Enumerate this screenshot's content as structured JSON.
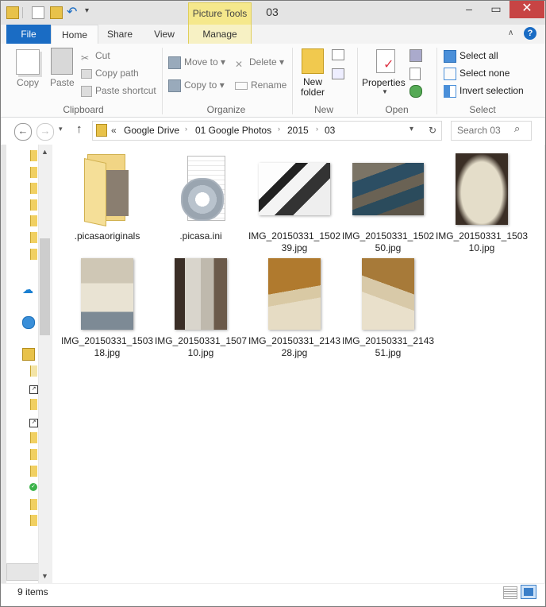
{
  "window": {
    "title": "03",
    "context_tab": "Picture Tools"
  },
  "tabs": {
    "file": "File",
    "home": "Home",
    "share": "Share",
    "view": "View",
    "manage": "Manage"
  },
  "ribbon": {
    "clipboard": {
      "copy": "Copy",
      "paste": "Paste",
      "cut": "Cut",
      "copy_path": "Copy path",
      "paste_shortcut": "Paste shortcut",
      "label": "Clipboard"
    },
    "organize": {
      "move_to": "Move to",
      "copy_to": "Copy to",
      "delete": "Delete",
      "rename": "Rename",
      "label": "Organize"
    },
    "new": {
      "new_folder_line1": "New",
      "new_folder_line2": "folder",
      "label": "New"
    },
    "open": {
      "properties": "Properties",
      "label": "Open"
    },
    "select": {
      "select_all": "Select all",
      "select_none": "Select none",
      "invert": "Invert selection",
      "label": "Select"
    }
  },
  "nav": {
    "breadcrumb": [
      "«",
      "Google Drive",
      "01 Google Photos",
      "2015",
      "03"
    ],
    "search_placeholder": "Search 03"
  },
  "files": [
    {
      "name": ".picasaoriginals",
      "kind": "folder"
    },
    {
      "name": ".picasa.ini",
      "kind": "ini"
    },
    {
      "name": "IMG_20150331_150239.jpg",
      "kind": "phones-bw"
    },
    {
      "name": "IMG_20150331_150250.jpg",
      "kind": "phones-color"
    },
    {
      "name": "IMG_20150331_150310.jpg",
      "kind": "box-tall"
    },
    {
      "name": "IMG_20150331_150318.jpg",
      "kind": "box-open"
    },
    {
      "name": "IMG_20150331_150710.jpg",
      "kind": "box-side"
    },
    {
      "name": "IMG_20150331_214328.jpg",
      "kind": "wood-floor"
    },
    {
      "name": "IMG_20150331_214351.jpg",
      "kind": "wood-floor2"
    }
  ],
  "status": {
    "count": "9 items"
  },
  "colors": {
    "accent": "#1a6cc4",
    "close": "#c74444",
    "context": "#f5e88c"
  }
}
